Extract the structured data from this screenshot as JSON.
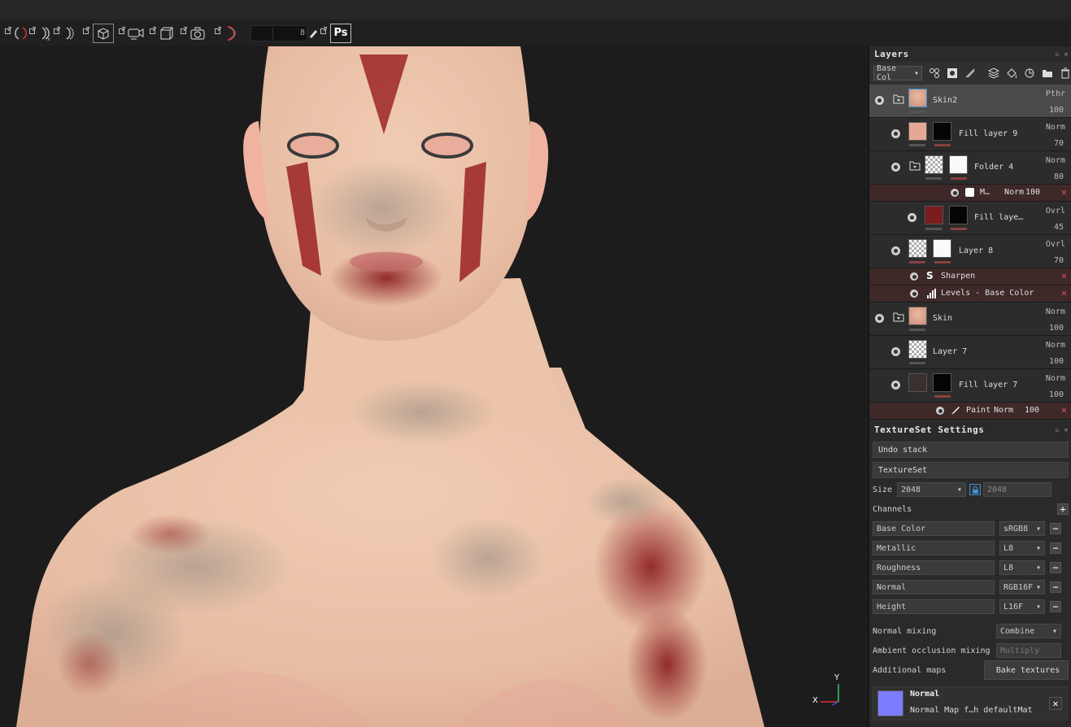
{
  "toolbar": {
    "brush_value": "8",
    "photoshop_label": "Ps",
    "icons": [
      "popout-icon",
      "symmetry-icon",
      "popout-icon",
      "symmetry-x-icon",
      "popout-icon",
      "symmetry-y-icon",
      "popout-icon",
      "camera-cube-icon",
      "popout-icon",
      "camera-icon",
      "popout-icon",
      "box-icon",
      "popout-icon",
      "screenshot-icon",
      "popout-icon",
      "moon-icon",
      "popout-icon",
      "pen-icon",
      "popout-icon",
      "photoshop-icon"
    ]
  },
  "layers": {
    "title": "Layers",
    "channel_select": "Base Col",
    "rows": [
      {
        "name": "Skin2",
        "blend": "Pthr",
        "opacity": "100",
        "selected": true
      },
      {
        "name": "Fill layer 9",
        "blend": "Norm",
        "opacity": "70"
      },
      {
        "name": "Folder 4",
        "blend": "Norm",
        "opacity": "80"
      },
      {
        "name": "M…",
        "blend": "Norm",
        "opacity": "100"
      },
      {
        "name": "Fill laye…",
        "blend": "Ovrl",
        "opacity": "45"
      },
      {
        "name": "Layer 8",
        "blend": "Ovrl",
        "opacity": "70"
      },
      {
        "name": "Sharpen"
      },
      {
        "name": "Levels - Base Color"
      },
      {
        "name": "Skin",
        "blend": "Norm",
        "opacity": "100"
      },
      {
        "name": "Layer 7",
        "blend": "Norm",
        "opacity": "100"
      },
      {
        "name": "Fill layer 7",
        "blend": "Norm",
        "opacity": "100"
      },
      {
        "name": "Paint",
        "blend": "Norm",
        "opacity": "100"
      }
    ]
  },
  "textureset": {
    "title": "TextureSet Settings",
    "undo_stack": "Undo stack",
    "textureset": "TextureSet",
    "size_label": "Size",
    "size_value": "2048",
    "size_value2": "2048",
    "channels_label": "Channels",
    "channels": [
      {
        "name": "Base Color",
        "format": "sRGB8"
      },
      {
        "name": "Metallic",
        "format": "L8"
      },
      {
        "name": "Roughness",
        "format": "L8"
      },
      {
        "name": "Normal",
        "format": "RGB16F"
      },
      {
        "name": "Height",
        "format": "L16F"
      }
    ],
    "normal_mixing_label": "Normal mixing",
    "normal_mixing_value": "Combine",
    "ao_mixing_label": "Ambient occlusion mixing",
    "ao_mixing_value": "Multiply",
    "additional_maps_label": "Additional maps",
    "bake_button": "Bake textures",
    "map_card": {
      "title": "Normal",
      "subtitle": "Normal Map f…h defaultMat",
      "color": "#7b7cff"
    }
  },
  "gizmo": {
    "x": "X",
    "y": "Y"
  },
  "colors": {
    "accent_blue": "#3d8fd1",
    "effect_row": "#3e2828",
    "delete_red": "#d55555"
  }
}
